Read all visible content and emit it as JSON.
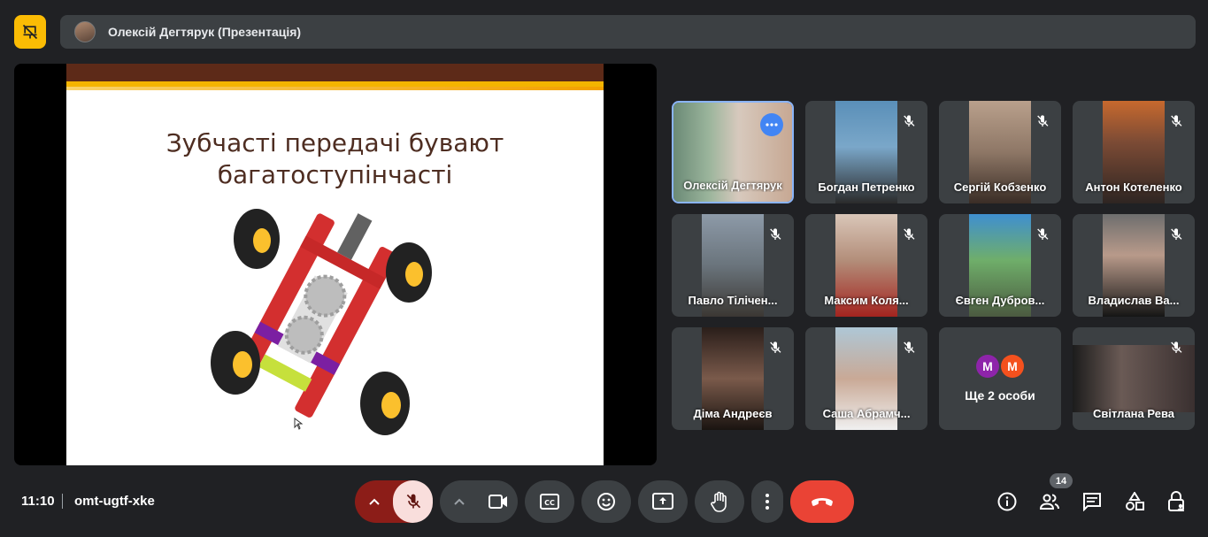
{
  "presenter": {
    "name": "Олексій Дегтярук (Презентація)"
  },
  "slide": {
    "title_line1": "Зубчасті передачі бувают",
    "title_line2": "багатоступінчасті"
  },
  "participants": [
    {
      "name": "Олексій Дегтярук",
      "muted": false,
      "active": true
    },
    {
      "name": "Богдан Петренко",
      "muted": true
    },
    {
      "name": "Сергій Кобзенко",
      "muted": true
    },
    {
      "name": "Антон Котеленко",
      "muted": true
    },
    {
      "name": "Павло Тілічен...",
      "muted": true
    },
    {
      "name": "Максим Коля...",
      "muted": true
    },
    {
      "name": "Євген Дубров...",
      "muted": true
    },
    {
      "name": "Владислав Ва...",
      "muted": true
    },
    {
      "name": "Діма Андреєв",
      "muted": true
    },
    {
      "name": "Саша Абрамч...",
      "muted": true
    },
    {
      "name": "Світлана Рева",
      "muted": true
    }
  ],
  "others": {
    "label": "Ще 2 особи",
    "avatars": [
      {
        "letter": "M",
        "color": "#8e24aa"
      },
      {
        "letter": "M",
        "color": "#f4511e"
      }
    ]
  },
  "meeting": {
    "time": "11:10",
    "code": "omt-ugtf-xke",
    "participant_count": "14"
  },
  "colors": {
    "background": "#202124",
    "surface": "#3c4043",
    "accent_pin": "#fbbc04",
    "end_call": "#ea4335",
    "mic_off_bg": "#f9dedc",
    "mic_group_bg": "#8c1d18",
    "active_border": "#8ab4f8"
  }
}
